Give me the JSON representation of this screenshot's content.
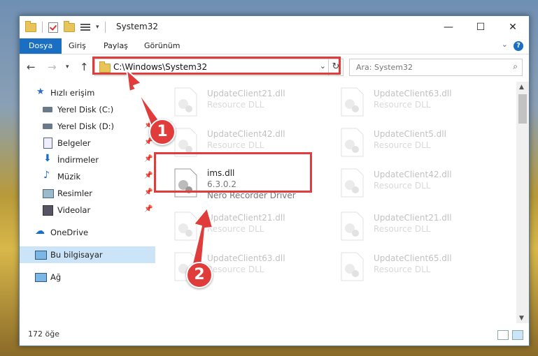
{
  "window": {
    "title": "System32",
    "controls": {
      "minimize": "—",
      "maximize": "☐",
      "close": "✕"
    }
  },
  "ribbon": {
    "tabs": [
      "Dosya",
      "Giriş",
      "Paylaş",
      "Görünüm"
    ],
    "help": "?"
  },
  "nav": {
    "address": "C:\\Windows\\System32",
    "search_placeholder": "Ara: System32"
  },
  "sidebar": {
    "items": [
      {
        "label": "Hızlı erişim",
        "icon": "star-icon"
      },
      {
        "label": "Yerel Disk (C:)",
        "icon": "drive-icon"
      },
      {
        "label": "Yerel Disk (D:)",
        "icon": "drive-icon"
      },
      {
        "label": "Belgeler",
        "icon": "documents-icon"
      },
      {
        "label": "İndirmeler",
        "icon": "download-icon"
      },
      {
        "label": "Müzik",
        "icon": "music-icon"
      },
      {
        "label": "Resimler",
        "icon": "pictures-icon"
      },
      {
        "label": "Videolar",
        "icon": "videos-icon"
      },
      {
        "label": "OneDrive",
        "icon": "cloud-icon"
      },
      {
        "label": "Bu bilgisayar",
        "icon": "computer-icon"
      },
      {
        "label": "Ağ",
        "icon": "network-icon"
      }
    ]
  },
  "files": [
    {
      "name": "UpdateClient21.dll",
      "sub": "Resource DLL"
    },
    {
      "name": "UpdateClient63.dll",
      "sub": "Resource DLL"
    },
    {
      "name": "UpdateClient42.dll",
      "sub": "Resource DLL"
    },
    {
      "name": "UpdateClient5.dll",
      "sub": "Resource DLL"
    },
    {
      "name": "ims.dll",
      "version": "6.3.0.2",
      "sub": "Nero Recorder Driver"
    },
    {
      "name": "UpdateClient42.dll",
      "sub": "Resource DLL"
    },
    {
      "name": "UpdateClient21.dll",
      "sub": "Resource DLL"
    },
    {
      "name": "UpdateClient21.dll",
      "sub": "Resource DLL"
    },
    {
      "name": "UpdateClient63.dll",
      "sub": "Resource DLL"
    },
    {
      "name": "UpdateClient65.dll",
      "sub": "Resource DLL"
    }
  ],
  "status": {
    "count": "172 öğe"
  },
  "annotations": {
    "step1": "1",
    "step2": "2",
    "highlight_color": "#e03c3c"
  }
}
